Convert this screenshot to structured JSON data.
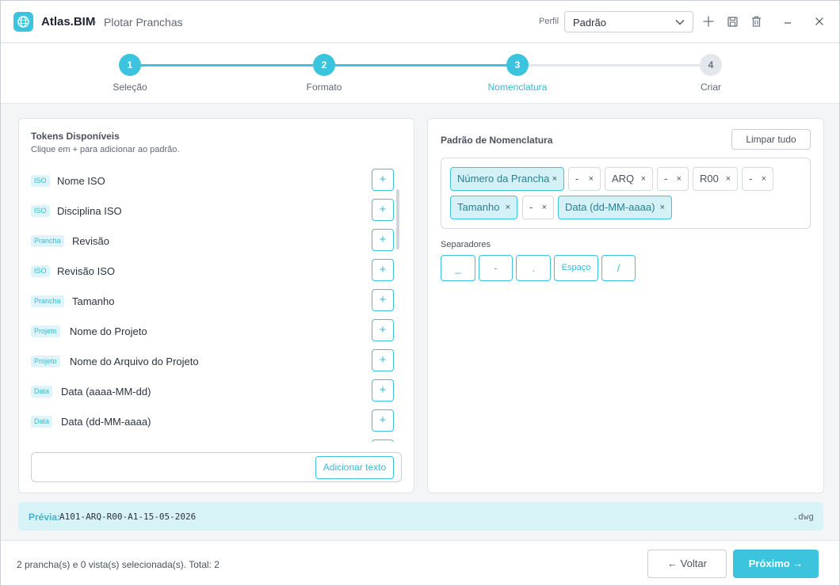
{
  "app": {
    "name": "Atlas.BIM",
    "separator": "·",
    "subtitle": "Plotar Pranchas",
    "logo_icon": "globe-icon"
  },
  "profile": {
    "label": "Perfil",
    "value": "Padrão"
  },
  "titlebar_icons": [
    "plus-icon",
    "save-icon",
    "trash-icon",
    "minimize-icon",
    "close-icon"
  ],
  "steps": [
    {
      "number": "1",
      "label": "Seleção",
      "state": "done"
    },
    {
      "number": "2",
      "label": "Formato",
      "state": "done"
    },
    {
      "number": "3",
      "label": "Nomenclatura",
      "state": "active"
    },
    {
      "number": "4",
      "label": "Criar",
      "state": "todo"
    }
  ],
  "tokens_panel": {
    "title": "Tokens Disponíveis",
    "hint": "Clique em + para adicionar ao padrão.",
    "items": [
      {
        "tag": "ISO",
        "name": "Nome ISO"
      },
      {
        "tag": "ISO",
        "name": "Disciplina ISO"
      },
      {
        "tag": "Prancha",
        "name": "Revisão"
      },
      {
        "tag": "ISO",
        "name": "Revisão ISO"
      },
      {
        "tag": "Prancha",
        "name": "Tamanho"
      },
      {
        "tag": "Projeto",
        "name": "Nome do Projeto"
      },
      {
        "tag": "Projeto",
        "name": "Nome do Arquivo do Projeto"
      },
      {
        "tag": "Data",
        "name": "Data (aaaa-MM-dd)"
      },
      {
        "tag": "Data",
        "name": "Data (dd-MM-aaaa)"
      }
    ],
    "add_symbol": "+",
    "add_text_button": "Adicionar texto"
  },
  "pattern_panel": {
    "title": "Padrão de Nomenclatura",
    "clear_button": "Limpar tudo",
    "chips": [
      {
        "label": "Número da Prancha",
        "kind": "token"
      },
      {
        "label": "-",
        "kind": "text"
      },
      {
        "label": "ARQ",
        "kind": "text"
      },
      {
        "label": "-",
        "kind": "text"
      },
      {
        "label": "R00",
        "kind": "text"
      },
      {
        "label": "-",
        "kind": "text"
      },
      {
        "label": "Tamanho",
        "kind": "token"
      },
      {
        "label": "-",
        "kind": "text"
      },
      {
        "label": "Data (dd-MM-aaaa)",
        "kind": "token"
      }
    ],
    "remove_symbol": "×",
    "separators_label": "Separadores",
    "separators": [
      "_",
      "-",
      ".",
      "Espaço",
      "/"
    ]
  },
  "preview": {
    "label": "Prévia:",
    "value": "A101-ARQ-R00-A1-15-05-2026",
    "extension": ".dwg"
  },
  "footer": {
    "status": "2 prancha(s) e 0 vista(s) selecionada(s). Total: 2",
    "back_button": "← Voltar",
    "next_button": "Próximo →"
  },
  "colors": {
    "accent": "#3cc3dd",
    "accent_text": "#3cb6cf",
    "chip_fill": "#d3f1f7",
    "preview_bg": "#d8f3f8"
  }
}
